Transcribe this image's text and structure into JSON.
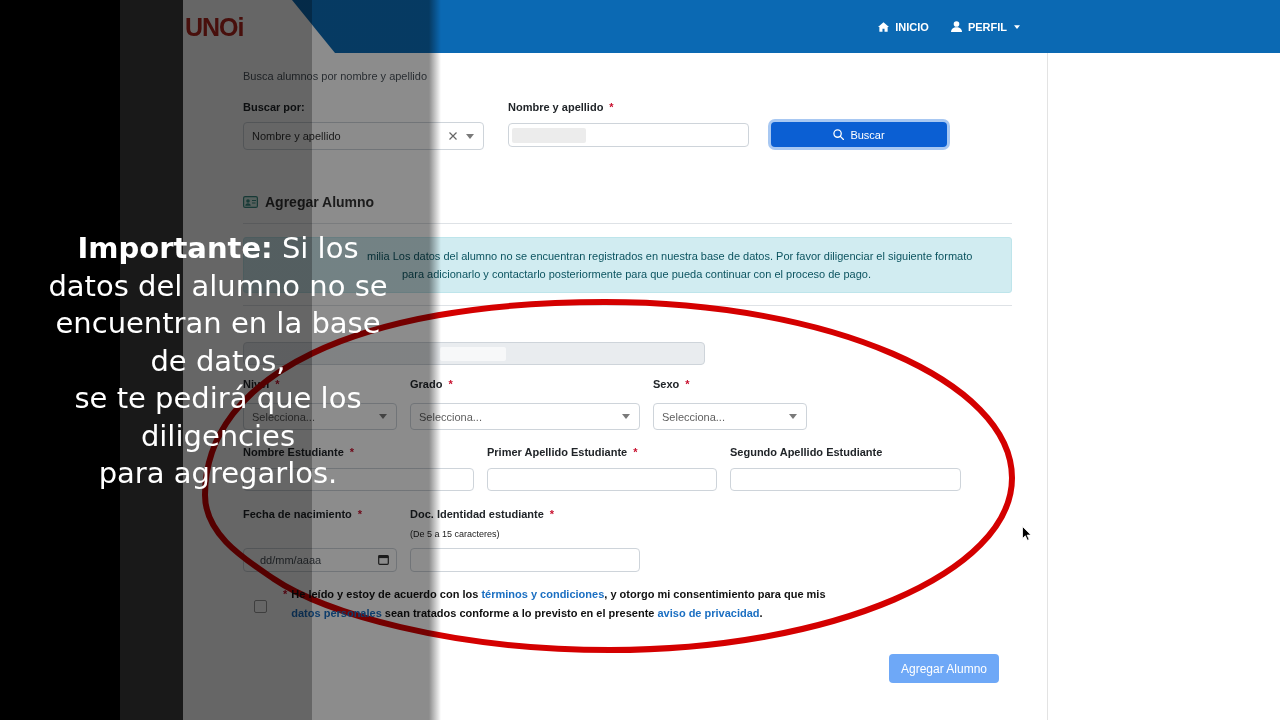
{
  "header": {
    "logo": "UNOi",
    "nav": [
      {
        "label": "INICIO",
        "dropdown": false
      },
      {
        "label": "PERFIL",
        "dropdown": true
      }
    ]
  },
  "search": {
    "hint": "Busca alumnos por nombre y apellido",
    "by": {
      "label": "Buscar por:",
      "value": "Nombre y apellido",
      "clearable": true
    },
    "name": {
      "label": "Nombre y apellido",
      "mark": "*",
      "redacted": true
    },
    "button": {
      "label": "Buscar",
      "focused": true
    }
  },
  "add_student": {
    "title": "Agregar Alumno",
    "alert": "milia Los datos del alumno no se encuentran registrados en nuestra base de datos. Por favor diligenciar el siguiente formato\npara adicionarlo y contactarlo posteriormente para que pueda continuar con el proceso de pago.",
    "school": {
      "disabled": true,
      "redacted": true
    },
    "fields": [
      {
        "kind": "select",
        "label": "Nivel",
        "mark": "*",
        "placeholder": "Selecciona..."
      },
      {
        "kind": "select",
        "label": "Grado",
        "mark": "*",
        "placeholder": "Selecciona..."
      },
      {
        "kind": "select",
        "label": "Sexo",
        "mark": "*",
        "placeholder": "Selecciona..."
      },
      {
        "kind": "text",
        "label": "Nombre Estudiante",
        "mark": "*"
      },
      {
        "kind": "text",
        "label": "Primer Apellido Estudiante",
        "mark": "*"
      },
      {
        "kind": "text",
        "label": "Segundo Apellido Estudiante"
      },
      {
        "kind": "date",
        "label": "Fecha de nacimiento",
        "mark": "*",
        "placeholder": "dd/mm/aaaa"
      },
      {
        "kind": "text",
        "label": "Doc. Identidad estudiante",
        "mark": "*",
        "hint": "(De 5 a 15 caracteres)"
      }
    ],
    "consent": {
      "mark": "*",
      "checked": false,
      "parts": [
        {
          "kind": "text",
          "text": "He leído y estoy de acuerdo con los "
        },
        {
          "kind": "link",
          "text": "términos y condiciones"
        },
        {
          "kind": "text",
          "text": ", y otorgo mi consentimiento para que mis "
        },
        {
          "kind": "link",
          "text": "datos personales"
        },
        {
          "kind": "text",
          "text": " sean tratados conforme a lo previsto en el presente "
        },
        {
          "kind": "link",
          "text": "aviso de privacidad"
        },
        {
          "kind": "text",
          "text": "."
        }
      ]
    },
    "submit": {
      "label": "Agregar Alumno",
      "disabled": true
    }
  },
  "caption": {
    "lines": [
      "**Importante:** Si los",
      "datos del alumno no se",
      "encuentran en la base",
      "de datos,",
      "se te pedirá que los",
      "diligencies",
      "para agregarlos."
    ]
  }
}
